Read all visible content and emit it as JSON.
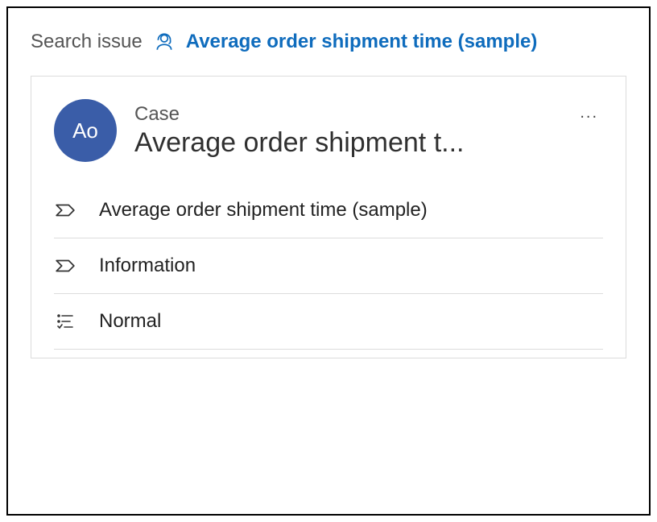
{
  "breadcrumb": {
    "start": "Search issue",
    "current": "Average order shipment time (sample)"
  },
  "card": {
    "avatar_initials": "Ao",
    "entity_type": "Case",
    "title": "Average order shipment t...",
    "more_label": "..."
  },
  "rows": [
    {
      "label": "Average order shipment time (sample)",
      "icon": "process-stage"
    },
    {
      "label": "Information",
      "icon": "process-stage"
    },
    {
      "label": "Normal",
      "icon": "priority-list"
    }
  ],
  "colors": {
    "link": "#0f6cbd",
    "avatar_bg": "#3a5da8"
  }
}
